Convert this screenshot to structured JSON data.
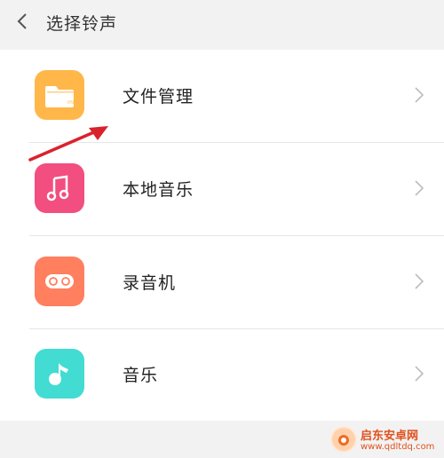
{
  "header": {
    "title": "选择铃声"
  },
  "items": [
    {
      "label": "文件管理",
      "icon": "folder-icon",
      "color": "#ffb74a"
    },
    {
      "label": "本地音乐",
      "icon": "music-note-icon",
      "color": "#f24e80"
    },
    {
      "label": "录音机",
      "icon": "recorder-icon",
      "color": "#ff7f5f"
    },
    {
      "label": "音乐",
      "icon": "music-app-icon",
      "color": "#42dcd2"
    }
  ],
  "watermark": {
    "line1": "启东安卓网",
    "line2": "www.qdltdq.com"
  }
}
